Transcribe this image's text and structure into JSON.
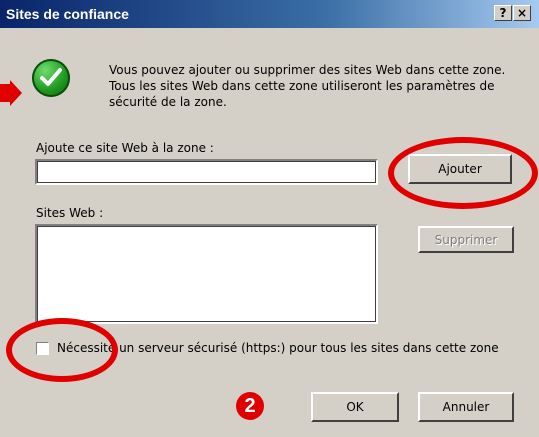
{
  "window": {
    "title": "Sites de confiance",
    "help_button": "?",
    "close_button": "×"
  },
  "message": "Vous pouvez ajouter ou supprimer des sites Web dans cette zone. Tous les sites Web dans cette zone utiliseront les paramètres de sécurité de la zone.",
  "add_section": {
    "label": "Ajoute ce site Web à la zone :",
    "input_value": "",
    "add_button": "Ajouter"
  },
  "sites_section": {
    "label": "Sites Web :",
    "items": [],
    "remove_button": "Supprimer"
  },
  "https_checkbox": {
    "label": "Nécessite un serveur sécurisé (https:) pour tous les sites dans cette zone",
    "checked": false
  },
  "footer": {
    "ok_button": "OK",
    "cancel_button": "Annuler"
  },
  "annotations": {
    "step_number": "2",
    "highlight_color": "#e00000"
  }
}
